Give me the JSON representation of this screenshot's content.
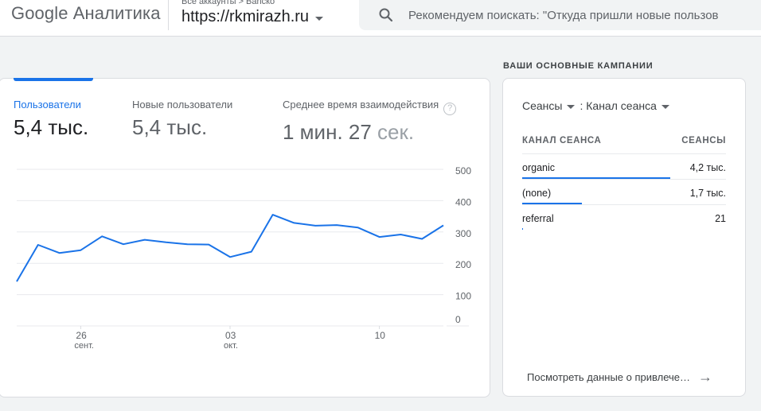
{
  "app": {
    "title": "Google Аналитика"
  },
  "header": {
    "breadcrumb": "Все аккаунты > Banско",
    "property": "https://rkmirazh.ru",
    "search_placeholder": "Рекомендуем поискать: \"Откуда пришли новые пользов"
  },
  "metrics": [
    {
      "label": "Пользователи",
      "value": "5,4 тыс."
    },
    {
      "label": "Новые пользователи",
      "value": "5,4 тыс."
    },
    {
      "label": "Среднее время взаимодействия",
      "value_main": "1 мин. 27",
      "value_tail": "сек.",
      "help": "?"
    }
  ],
  "chart_data": {
    "type": "line",
    "series": [
      {
        "values": [
          142,
          259,
          233,
          242,
          286,
          261,
          275,
          267,
          261,
          260,
          220,
          237,
          355,
          329,
          320,
          322,
          314,
          284,
          292,
          278,
          321
        ]
      }
    ],
    "y_ticks": [
      "500",
      "400",
      "300",
      "200",
      "100",
      "0"
    ],
    "ylim": [
      0,
      500
    ],
    "x_ticks": [
      {
        "day": "26",
        "month": "сент."
      },
      {
        "day": "03",
        "month": "окт."
      },
      {
        "day": "10",
        "month": ""
      }
    ],
    "color": "#1a73e8",
    "grid": true
  },
  "campaigns": {
    "title": "ВАШИ ОСНОВНЫЕ КАМПАНИИ",
    "metric_dropdown": "Сеансы",
    "dimension_dropdown": ": Канал сеанса",
    "col_channel": "КАНАЛ СЕАНСА",
    "col_sessions": "СЕАНСЫ",
    "rows": [
      {
        "channel": "organic",
        "sessions": "4,2 тыс.",
        "share": 0.72
      },
      {
        "channel": "(none)",
        "sessions": "1,7 тыс.",
        "share": 0.29
      },
      {
        "channel": "referral",
        "sessions": "21",
        "share": 0.005
      }
    ],
    "view_link": "Посмотреть данные о привлече…",
    "accent": "#1a73e8"
  }
}
